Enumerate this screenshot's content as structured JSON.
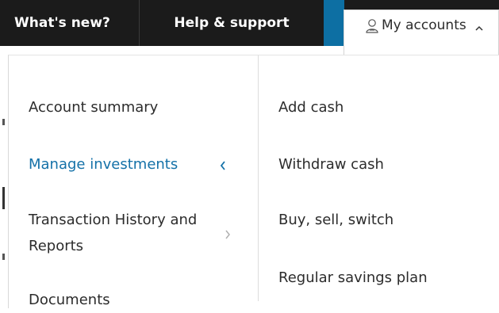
{
  "topnav": {
    "whats_new": "What's new?",
    "help_support": "Help & support",
    "my_accounts": "My accounts"
  },
  "menu": {
    "left": [
      {
        "label": "Account summary",
        "active": false
      },
      {
        "label": "Manage investments",
        "active": true
      },
      {
        "label": "Transaction History and Reports",
        "active": false
      },
      {
        "label": "Documents",
        "active": false
      }
    ],
    "right": [
      {
        "label": "Add cash"
      },
      {
        "label": "Withdraw cash"
      },
      {
        "label": "Buy, sell, switch"
      },
      {
        "label": "Regular savings plan"
      }
    ]
  },
  "colors": {
    "topbar": "#1b1b1b",
    "accent_blue": "#0d6fa3",
    "active_text": "#1471a8"
  },
  "icons": {
    "account": "user-icon",
    "dropdown": "chevron-up-icon",
    "active_item": "chevron-left-icon",
    "submenu": "chevron-right-icon"
  }
}
